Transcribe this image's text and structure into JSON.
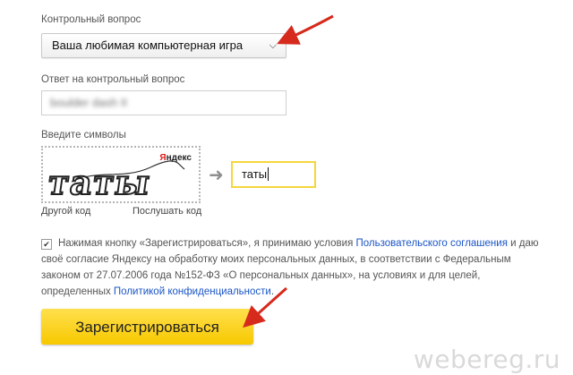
{
  "security_question": {
    "label": "Контрольный вопрос",
    "selected": "Ваша любимая компьютерная игра",
    "chevron_icon": "chevron-down-icon"
  },
  "answer": {
    "label": "Ответ на контрольный вопрос",
    "value": "boulder dash II"
  },
  "captcha": {
    "label": "Введите символы",
    "logo_first": "Я",
    "logo_rest": "ндекс",
    "word": "таты",
    "other_code": "Другой код",
    "listen_code": "Послушать код",
    "input_value": "таты",
    "arrow_icon": "arrow-right-icon"
  },
  "agreement": {
    "checked": true,
    "text_before": "Нажимая кнопку «Зарегистрироваться», я принимаю условия ",
    "link_terms": "Пользовательского соглашения",
    "text_middle": " и даю своё согласие Яндексу на обработку моих персональных данных, в соответствии с Федеральным законом от 27.07.2006 года №152-ФЗ «О персональных данных», на условиях и для целей, определенных ",
    "link_privacy": "Политикой конфиденциальности",
    "text_after": "."
  },
  "register_button": {
    "label": "Зарегистрироваться"
  },
  "watermark": "webereg.ru",
  "colors": {
    "button_yellow": "#ffdb4d",
    "link_blue": "#1a55c7",
    "annotation_red": "#d62a1d"
  }
}
